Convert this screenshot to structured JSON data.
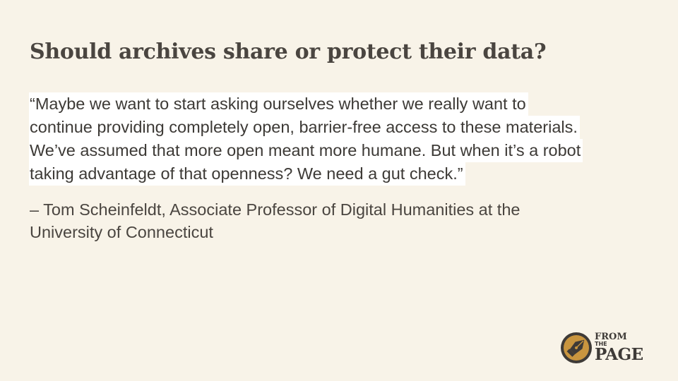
{
  "slide": {
    "title": "Should archives share or protect their data?",
    "quote_lines": [
      "“Maybe we want to start asking ourselves whether we really want to",
      "continue providing completely open, barrier-free access to these materials.",
      "We’ve assumed that more open meant more humane. But when it’s a robot",
      "taking advantage of that openness? We need a gut check.”"
    ],
    "attribution_lines": [
      "– Tom Scheinfeldt, Associate Professor of Digital Humanities at the",
      "University of Connecticut"
    ]
  },
  "logo": {
    "icon": "fountain-pen-nib-icon",
    "word1": "FROM",
    "word2": "THE",
    "word3": "PAGE",
    "accent_color": "#c9953f",
    "dark_color": "#3e3a37"
  }
}
